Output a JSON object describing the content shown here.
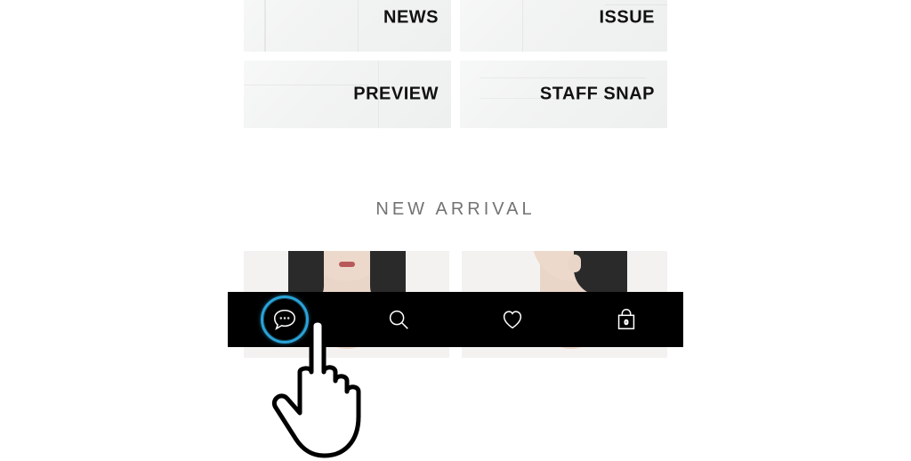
{
  "tiles": [
    {
      "label": "NEWS"
    },
    {
      "label": "ISSUE"
    },
    {
      "label": "PREVIEW"
    },
    {
      "label": "STAFF SNAP"
    }
  ],
  "section": {
    "new_arrival_title": "NEW ARRIVAL"
  },
  "tabbar": {
    "items": [
      {
        "name": "chat",
        "highlighted": true
      },
      {
        "name": "search",
        "highlighted": false
      },
      {
        "name": "favorites",
        "highlighted": false
      },
      {
        "name": "bag",
        "highlighted": false
      }
    ],
    "bag_badge": "0"
  },
  "colors": {
    "highlight": "#2aa3d8",
    "tabbar_bg": "#000000"
  }
}
